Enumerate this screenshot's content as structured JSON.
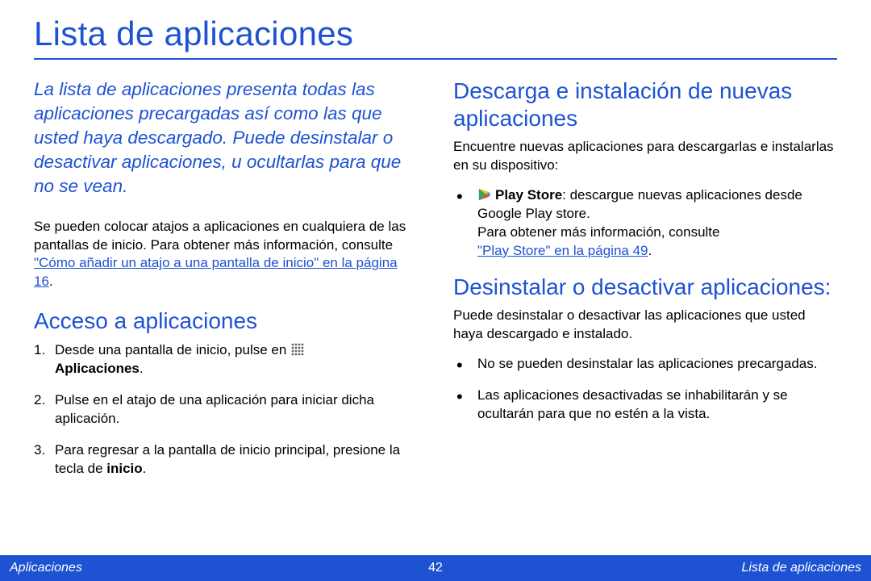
{
  "header": {
    "title": "Lista de aplicaciones"
  },
  "left": {
    "intro": "La lista de aplicaciones presenta todas las aplicaciones precargadas así como las que usted haya descargado. Puede desinstalar o desactivar aplicaciones, u ocultarlas para que no se vean.",
    "body_pre": "Se pueden colocar atajos a aplicaciones en cualquiera de las pantallas de inicio. Para obtener más información, consulte ",
    "body_link": "\"Cómo añadir un atajo a una pantalla de inicio\" en la página 16",
    "body_post": ".",
    "section_title": "Acceso a aplicaciones",
    "step1_pre": "Desde una pantalla de inicio, pulse en ",
    "step1_post": "Aplicaciones",
    "step1_end": ".",
    "step2": "Pulse en el atajo de una aplicación para iniciar dicha aplicación.",
    "step3_pre": "Para regresar a la pantalla de inicio principal, presione la tecla de ",
    "step3_bold": "inicio",
    "step3_end": "."
  },
  "right": {
    "sec1_title": "Descarga e instalación de nuevas aplicaciones",
    "sec1_intro": "Encuentre nuevas aplicaciones para descargarlas e instalarlas en su dispositivo:",
    "bullet1_bold": "Play Store",
    "bullet1_rest": ": descargue nuevas aplicaciones desde Google Play store.",
    "bullet1_line2": "Para obtener más información, consulte ",
    "bullet1_link": "\"Play Store\" en la página 49",
    "bullet1_end": ".",
    "sec2_title": "Desinstalar o desactivar aplicaciones:",
    "sec2_intro": "Puede desinstalar o desactivar las aplicaciones que usted haya descargado e instalado.",
    "bullet_a": "No se pueden desinstalar las aplicaciones precargadas.",
    "bullet_b": "Las aplicaciones desactivadas se inhabilitarán y se ocultarán para que no estén a la vista."
  },
  "footer": {
    "left": "Aplicaciones",
    "center": "42",
    "right": "Lista de aplicaciones"
  }
}
